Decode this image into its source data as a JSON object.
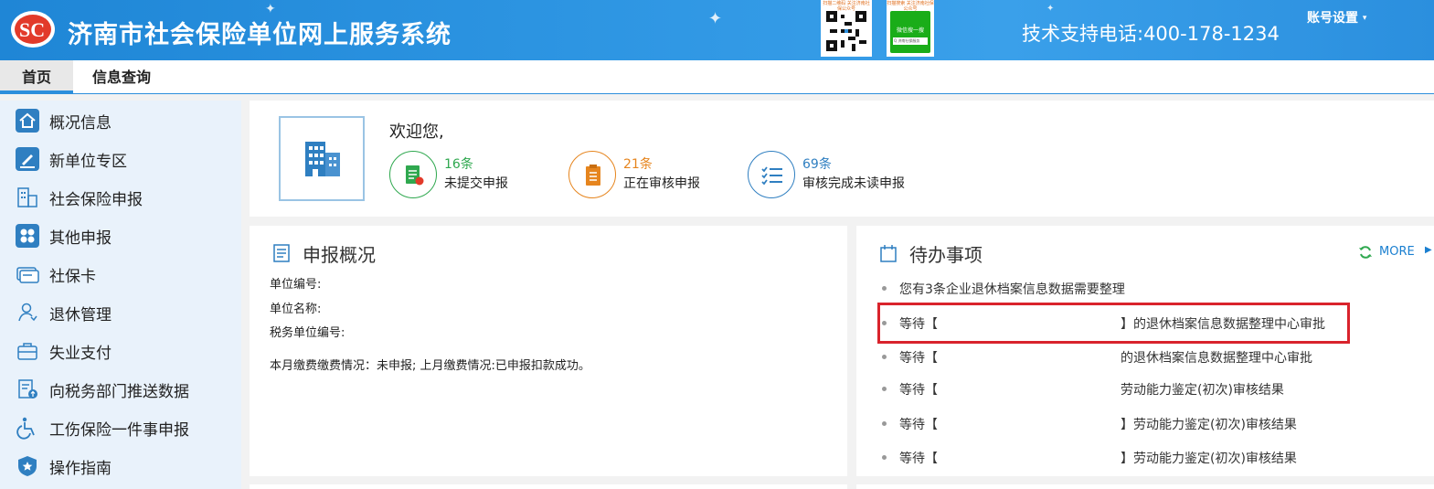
{
  "header": {
    "title": "济南市社会保险单位网上服务系统",
    "support": "技术支持电话:400-178-1234",
    "account": "账号设置",
    "qr1_caption": "扫描二维码 关注济南社保公众号",
    "qr2_caption": "扫描搜索 关注济南社保公众号",
    "qr2_search": "微信搜一搜",
    "qr2_search_sub": "Q 济南社保服务"
  },
  "tabs": [
    {
      "label": "首页"
    },
    {
      "label": "信息查询"
    }
  ],
  "sidebar": {
    "items": [
      {
        "label": "概况信息"
      },
      {
        "label": "新单位专区"
      },
      {
        "label": "社会保险申报"
      },
      {
        "label": "其他申报"
      },
      {
        "label": "社保卡"
      },
      {
        "label": "退休管理"
      },
      {
        "label": "失业支付"
      },
      {
        "label": "向税务部门推送数据"
      },
      {
        "label": "工伤保险一件事申报"
      },
      {
        "label": "操作指南"
      }
    ]
  },
  "welcome": {
    "greeting": "欢迎您,",
    "stats": [
      {
        "count": "16条",
        "desc": "未提交申报",
        "color": "#2fa84f"
      },
      {
        "count": "21条",
        "desc": "正在审核申报",
        "color": "#e6851e"
      },
      {
        "count": "69条",
        "desc": "审核完成未读申报",
        "color": "#2f7fc1"
      }
    ]
  },
  "overview": {
    "title": "申报概况",
    "unit_no": "单位编号:",
    "unit_name": "单位名称:",
    "tax_no": "税务单位编号:",
    "payment": "本月缴费缴费情况：未申报; 上月缴费情况:已申报扣款成功。"
  },
  "todo": {
    "title": "待办事项",
    "more": "MORE",
    "items": [
      {
        "prefix": "您有3条企业退休档案信息数据需要整理",
        "suffix": ""
      },
      {
        "prefix": "等待【",
        "suffix": "】的退休档案信息数据整理中心审批"
      },
      {
        "prefix": "等待【",
        "suffix": "的退休档案信息数据整理中心审批"
      },
      {
        "prefix": "等待【",
        "suffix": "劳动能力鉴定(初次)审核结果"
      },
      {
        "prefix": "等待【",
        "suffix": "】劳动能力鉴定(初次)审核结果"
      },
      {
        "prefix": "等待【",
        "suffix": "】劳动能力鉴定(初次)审核结果"
      }
    ]
  }
}
